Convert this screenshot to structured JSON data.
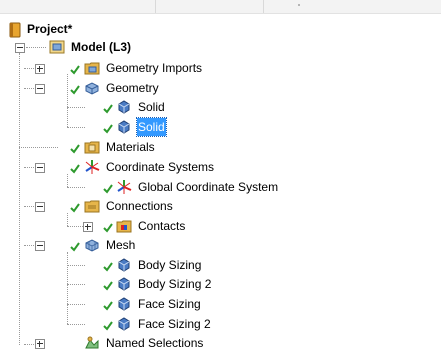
{
  "tree": {
    "project": {
      "label": "Project*"
    },
    "model": {
      "label": "Model (L3)"
    },
    "geometry_imports": {
      "label": "Geometry Imports"
    },
    "geometry": {
      "label": "Geometry"
    },
    "solid_1": {
      "label": "Solid"
    },
    "solid_2": {
      "label": "Solid"
    },
    "materials": {
      "label": "Materials"
    },
    "coordinate_systems": {
      "label": "Coordinate Systems"
    },
    "global_coordinate_system": {
      "label": "Global Coordinate System"
    },
    "connections": {
      "label": "Connections"
    },
    "contacts": {
      "label": "Contacts"
    },
    "mesh": {
      "label": "Mesh"
    },
    "body_sizing": {
      "label": "Body Sizing"
    },
    "body_sizing_2": {
      "label": "Body Sizing 2"
    },
    "face_sizing": {
      "label": "Face Sizing"
    },
    "face_sizing_2": {
      "label": "Face Sizing 2"
    },
    "named_selections": {
      "label": "Named Selections"
    }
  },
  "selected_item": "solid_2",
  "colors": {
    "selection": "#3399ff",
    "check": "#2e9a2e",
    "folder": "#e6b54a",
    "solid": "#4a7bc4"
  }
}
